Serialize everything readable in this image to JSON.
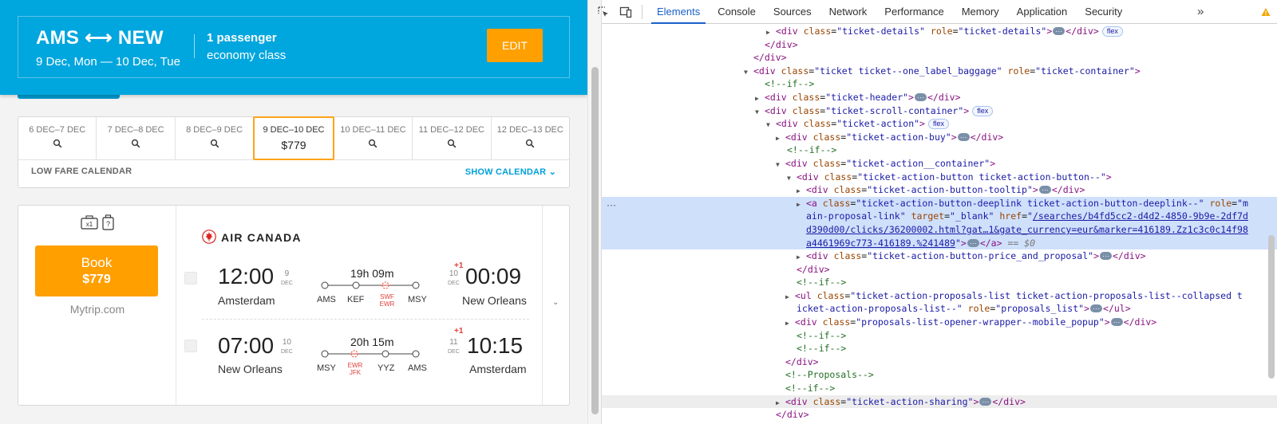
{
  "header": {
    "route": "AMS ⟷ NEW",
    "dates": "9 Dec, Mon — 10 Dec, Tue",
    "passengers": "1 passenger",
    "class": "economy class",
    "edit_label": "EDIT"
  },
  "date_strip": {
    "cells": [
      {
        "label": "6 DEC–7 DEC"
      },
      {
        "label": "7 DEC–8 DEC"
      },
      {
        "label": "8 DEC–9 DEC"
      },
      {
        "label": "9 DEC–10 DEC",
        "price": "$779"
      },
      {
        "label": "10 DEC–11 DEC"
      },
      {
        "label": "11 DEC–12 DEC"
      },
      {
        "label": "12 DEC–13 DEC"
      }
    ],
    "low_fare": "LOW FARE CALENDAR",
    "show_calendar": "SHOW CALENDAR"
  },
  "ticket": {
    "baggage_count": "x1",
    "book_label": "Book",
    "book_price": "$779",
    "agency": "Mytrip.com",
    "airline": "AIR CANADA",
    "segments": [
      {
        "dep_time": "12:00",
        "dep_day": "9",
        "dep_month": "DEC",
        "dep_city": "Amsterdam",
        "arr_time": "00:09",
        "arr_day": "10",
        "arr_month": "DEC",
        "arr_city": "New Orleans",
        "plus_day": "+1",
        "duration": "19h 09m",
        "stops": [
          "AMS",
          "KEF"
        ],
        "transfer": [
          "SWF",
          "EWR"
        ],
        "end_stop": "MSY"
      },
      {
        "dep_time": "07:00",
        "dep_day": "10",
        "dep_month": "DEC",
        "dep_city": "New Orleans",
        "arr_time": "10:15",
        "arr_day": "11",
        "arr_month": "DEC",
        "arr_city": "Amsterdam",
        "plus_day": "+1",
        "duration": "20h 15m",
        "stops": [
          "MSY"
        ],
        "transfer": [
          "EWR",
          "JFK"
        ],
        "mid_stop": "YYZ",
        "end_stop": "AMS"
      }
    ]
  },
  "devtools": {
    "tabs": [
      "Elements",
      "Console",
      "Sources",
      "Network",
      "Performance",
      "Memory",
      "Application",
      "Security"
    ],
    "active_tab": "Elements",
    "more": "»",
    "warn_count": "2",
    "badge_flex": "flex",
    "eq_dollar": "== $0",
    "code": {
      "l1_class": "\"ticket-details\"",
      "l1_role": "\"ticket-details\"",
      "l4_class": "\"ticket       ticket--one_label_baggage\"",
      "l4_role": "\"ticket-container\"",
      "l5": "<!--if-->",
      "l6_class": "\"ticket-header\"",
      "l7_class": "\"ticket-scroll-container\"",
      "l8_class": "\"ticket-action\"",
      "l9_class": "\"ticket-action-buy\"",
      "l10": "<!--if-->",
      "l11_class": "\"ticket-action__container\"",
      "l12_class": "\"ticket-action-button ticket-action-button--\"",
      "l13_class": "\"ticket-action-button-tooltip\"",
      "l14_class": "\"ticket-action-button-deeplink ticket-action-button-deeplink--\"",
      "l14_role_a": "\"m",
      "l15_role_b": "ain-proposal-link\"",
      "l15_target": "\"_blank\"",
      "l15_href_a": "/searches/b4fd5cc2-d4d2-4850-9b9e-2df7d",
      "l16_href_b": "d390d00/clicks/36200002.html?gat…1&gate_currency=eur&marker=416189.Zz1c3c0c14f98",
      "l17_href_c": "a4461969c773-416189.%241489",
      "l18_class": "\"ticket-action-button-price_and_proposal\"",
      "l20": "<!--if-->",
      "l21_class": "\"ticket-action-proposals-list ticket-action-proposals-list--collapsed  t",
      "l22_class": "icket-action-proposals-list--\"",
      "l22_role": "\"proposals_list\"",
      "l23_class": "\"proposals-list-opener-wrapper--mobile_popup\"",
      "l24": "<!--if-->",
      "l25": "<!--if-->",
      "l27": "<!--Proposals-->",
      "l28": "<!--if-->",
      "l29_class": "\"ticket-action-sharing\""
    }
  }
}
